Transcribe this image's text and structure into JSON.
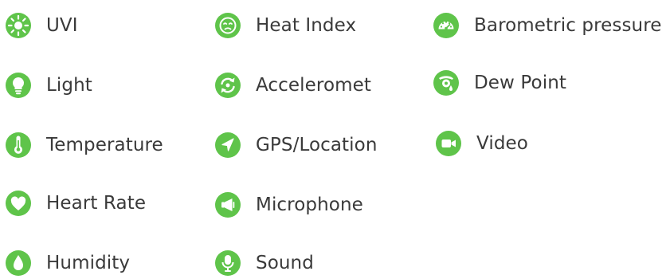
{
  "accent_color": "#5fc44a",
  "sensors": {
    "uvi": {
      "label": "UVI",
      "icon": "sun-icon"
    },
    "light": {
      "label": "Light",
      "icon": "lightbulb-icon"
    },
    "temperature": {
      "label": "Temperature",
      "icon": "thermometer-icon"
    },
    "heart_rate": {
      "label": "Heart Rate",
      "icon": "heart-icon"
    },
    "humidity": {
      "label": "Humidity",
      "icon": "droplet-icon"
    },
    "heat_index": {
      "label": "Heat Index",
      "icon": "sweating-face-icon"
    },
    "accelerometer": {
      "label": "Acceleromet",
      "icon": "rotate-arrows-icon"
    },
    "gps": {
      "label": "GPS/Location",
      "icon": "location-arrow-icon"
    },
    "microphone": {
      "label": "Microphone",
      "icon": "megaphone-icon"
    },
    "sound": {
      "label": "Sound",
      "icon": "microphone-icon"
    },
    "barometric_pressure": {
      "label": "Barometric pressure",
      "icon": "gauge-icon"
    },
    "dew_point": {
      "label": "Dew Point",
      "icon": "dew-drop-icon"
    },
    "video": {
      "label": "Video",
      "icon": "video-camera-icon"
    }
  }
}
